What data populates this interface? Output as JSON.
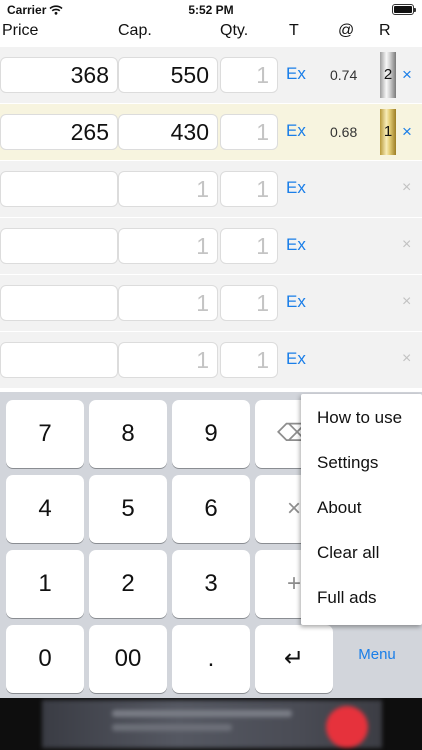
{
  "status_bar": {
    "carrier": "Carrier",
    "time": "5:52 PM",
    "battery_level": 1.0
  },
  "header": {
    "price": "Price",
    "cap": "Cap.",
    "qty": "Qty.",
    "t": "T",
    "at": "@",
    "r": "R"
  },
  "rows": [
    {
      "price": "368",
      "cap": "550",
      "qty": "1",
      "t": "Ex",
      "rate": "0.74",
      "rank": "2",
      "remove": "×"
    },
    {
      "price": "265",
      "cap": "430",
      "qty": "1",
      "t": "Ex",
      "rate": "0.68",
      "rank": "1",
      "remove": "×"
    },
    {
      "price": "",
      "cap": "1",
      "qty": "1",
      "t": "Ex",
      "remove": "×"
    },
    {
      "price": "",
      "cap": "1",
      "qty": "1",
      "t": "Ex",
      "remove": "×"
    },
    {
      "price": "",
      "cap": "1",
      "qty": "1",
      "t": "Ex",
      "remove": "×"
    },
    {
      "price": "",
      "cap": "1",
      "qty": "1",
      "t": "Ex",
      "remove": "×"
    }
  ],
  "keypad": {
    "k7": "7",
    "k8": "8",
    "k9": "9",
    "backspace": "⌫",
    "k4": "4",
    "k5": "5",
    "k6": "6",
    "multiply": "×",
    "k1": "1",
    "k2": "2",
    "k3": "3",
    "plus": "+",
    "k0": "0",
    "k00": "00",
    "dot": ".",
    "enter": "↵",
    "menu": "Menu"
  },
  "menu_popup": {
    "how_to_use": "How to use",
    "settings": "Settings",
    "about": "About",
    "clear_all": "Clear all",
    "full_ads": "Full ads"
  },
  "colors": {
    "accent": "#1a7ee8",
    "row_bg": "#f2f2f2",
    "row_highlight_bg": "#f7f4df",
    "keyboard_bg": "#d2d5db",
    "placeholder_text": "#c4c4c4"
  }
}
